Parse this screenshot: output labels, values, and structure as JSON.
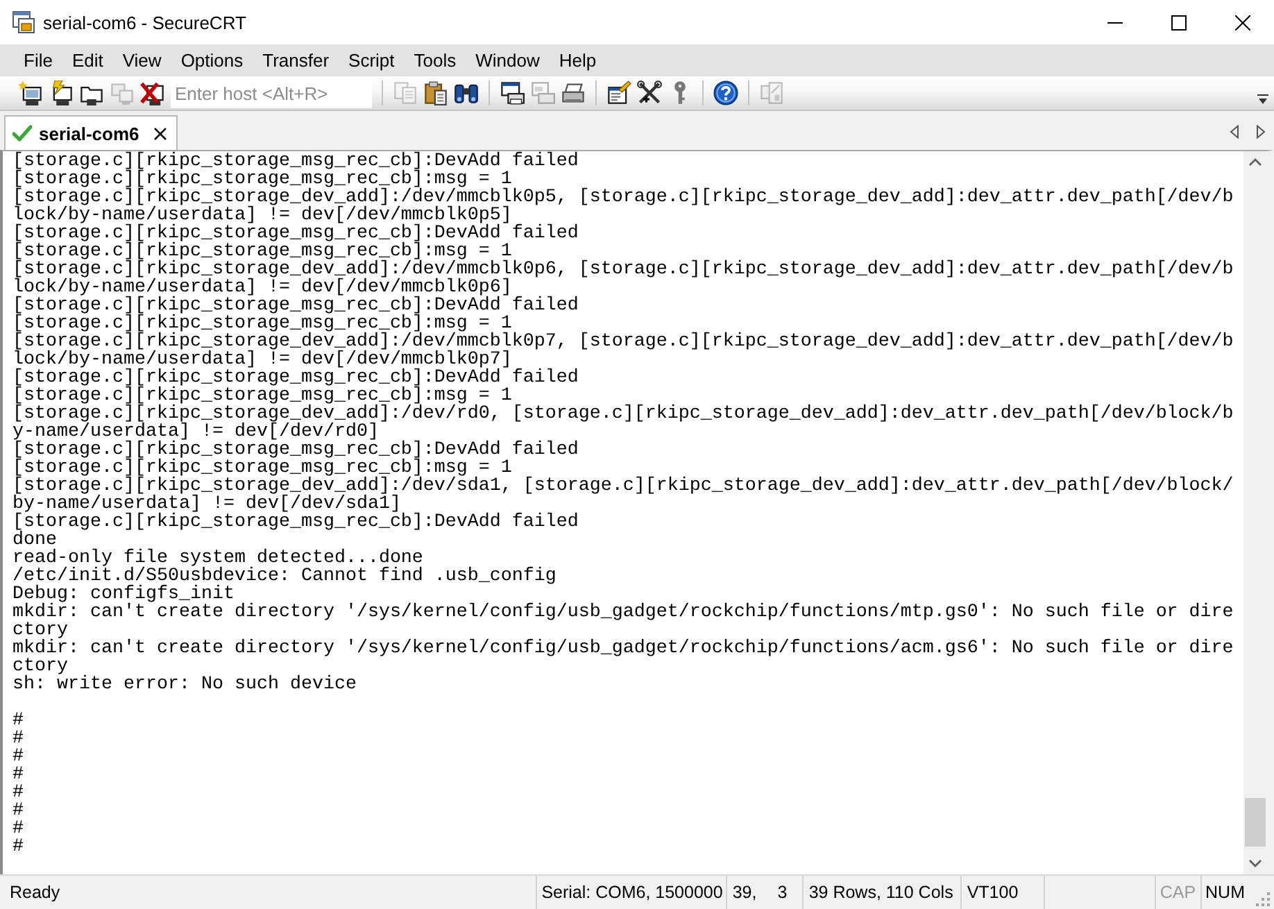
{
  "window": {
    "title": "serial-com6 - SecureCRT"
  },
  "menu": [
    {
      "label": "File"
    },
    {
      "label": "Edit"
    },
    {
      "label": "View"
    },
    {
      "label": "Options"
    },
    {
      "label": "Transfer"
    },
    {
      "label": "Script"
    },
    {
      "label": "Tools"
    },
    {
      "label": "Window"
    },
    {
      "label": "Help"
    }
  ],
  "toolbar": {
    "items": [
      {
        "kind": "connect",
        "disabled": false
      },
      {
        "kind": "quickconnect",
        "disabled": false
      },
      {
        "kind": "tabconnect",
        "disabled": false
      },
      {
        "kind": "reconnect",
        "disabled": true
      },
      {
        "kind": "disconnect",
        "disabled": false
      },
      {
        "kind": "host",
        "placeholder": "Enter host <Alt+R>"
      },
      {
        "kind": "separator"
      },
      {
        "kind": "copy",
        "disabled": true
      },
      {
        "kind": "paste",
        "disabled": false
      },
      {
        "kind": "find",
        "disabled": false
      },
      {
        "kind": "separator"
      },
      {
        "kind": "printscreen",
        "disabled": false
      },
      {
        "kind": "printselection",
        "disabled": true
      },
      {
        "kind": "print",
        "disabled": false
      },
      {
        "kind": "separator"
      },
      {
        "kind": "sessionoptions",
        "disabled": false
      },
      {
        "kind": "globaloptions",
        "disabled": false
      },
      {
        "kind": "keymap",
        "disabled": false
      },
      {
        "kind": "separator"
      },
      {
        "kind": "help",
        "disabled": false
      },
      {
        "kind": "separator"
      },
      {
        "kind": "tile",
        "disabled": true
      }
    ]
  },
  "tabs": [
    {
      "label": "serial-com6",
      "selected": true
    }
  ],
  "terminal": {
    "lines": [
      {
        "kind": "text",
        "text": "[storage.c][rkipc_storage_msg_rec_cb]:DevAdd failed"
      },
      {
        "kind": "text",
        "text": "[storage.c][rkipc_storage_msg_rec_cb]:msg = 1"
      },
      {
        "kind": "text",
        "text": "[storage.c][rkipc_storage_dev_add]:/dev/mmcblk0p5, [storage.c][rkipc_storage_dev_add]:dev_attr.dev_path[/dev/b"
      },
      {
        "kind": "text",
        "text": "lock/by-name/userdata] != dev[/dev/mmcblk0p5]"
      },
      {
        "kind": "text",
        "text": "[storage.c][rkipc_storage_msg_rec_cb]:DevAdd failed"
      },
      {
        "kind": "text",
        "text": "[storage.c][rkipc_storage_msg_rec_cb]:msg = 1"
      },
      {
        "kind": "text",
        "text": "[storage.c][rkipc_storage_dev_add]:/dev/mmcblk0p6, [storage.c][rkipc_storage_dev_add]:dev_attr.dev_path[/dev/b"
      },
      {
        "kind": "text",
        "text": "lock/by-name/userdata] != dev[/dev/mmcblk0p6]"
      },
      {
        "kind": "text",
        "text": "[storage.c][rkipc_storage_msg_rec_cb]:DevAdd failed"
      },
      {
        "kind": "text",
        "text": "[storage.c][rkipc_storage_msg_rec_cb]:msg = 1"
      },
      {
        "kind": "text",
        "text": "[storage.c][rkipc_storage_dev_add]:/dev/mmcblk0p7, [storage.c][rkipc_storage_dev_add]:dev_attr.dev_path[/dev/b"
      },
      {
        "kind": "text",
        "text": "lock/by-name/userdata] != dev[/dev/mmcblk0p7]"
      },
      {
        "kind": "text",
        "text": "[storage.c][rkipc_storage_msg_rec_cb]:DevAdd failed"
      },
      {
        "kind": "text",
        "text": "[storage.c][rkipc_storage_msg_rec_cb]:msg = 1"
      },
      {
        "kind": "text",
        "text": "[storage.c][rkipc_storage_dev_add]:/dev/rd0, [storage.c][rkipc_storage_dev_add]:dev_attr.dev_path[/dev/block/b"
      },
      {
        "kind": "text",
        "text": "y-name/userdata] != dev[/dev/rd0]"
      },
      {
        "kind": "text",
        "text": "[storage.c][rkipc_storage_msg_rec_cb]:DevAdd failed"
      },
      {
        "kind": "text",
        "text": "[storage.c][rkipc_storage_msg_rec_cb]:msg = 1"
      },
      {
        "kind": "text",
        "text": "[storage.c][rkipc_storage_dev_add]:/dev/sda1, [storage.c][rkipc_storage_dev_add]:dev_attr.dev_path[/dev/block/"
      },
      {
        "kind": "text",
        "text": "by-name/userdata] != dev[/dev/sda1]"
      },
      {
        "kind": "text",
        "text": "[storage.c][rkipc_storage_msg_rec_cb]:DevAdd failed"
      },
      {
        "kind": "text",
        "text": "done"
      },
      {
        "kind": "text",
        "text": "read-only file system detected...done"
      },
      {
        "kind": "text",
        "text": "/etc/init.d/S50usbdevice: Cannot find .usb_config"
      },
      {
        "kind": "text",
        "text": "Debug: configfs_init"
      },
      {
        "kind": "text",
        "text": "mkdir: can't create directory '/sys/kernel/config/usb_gadget/rockchip/functions/mtp.gs0': No such file or dire"
      },
      {
        "kind": "text",
        "text": "ctory"
      },
      {
        "kind": "text",
        "text": "mkdir: can't create directory '/sys/kernel/config/usb_gadget/rockchip/functions/acm.gs6': No such file or dire"
      },
      {
        "kind": "text",
        "text": "ctory"
      },
      {
        "kind": "text",
        "text": "sh: write error: No such device"
      },
      {
        "kind": "blank"
      },
      {
        "kind": "text",
        "text": "#"
      },
      {
        "kind": "text",
        "text": "#"
      },
      {
        "kind": "text",
        "text": "#"
      },
      {
        "kind": "text",
        "text": "#"
      },
      {
        "kind": "text",
        "text": "#"
      },
      {
        "kind": "text",
        "text": "#"
      },
      {
        "kind": "text",
        "text": "#"
      },
      {
        "kind": "text",
        "text": "#"
      }
    ]
  },
  "status_bar": {
    "message": "Ready",
    "connection": "Serial: COM6, 1500000",
    "cursor": {
      "row": "39,",
      "column": "3"
    },
    "size": "39 Rows, 110 Cols",
    "emulation": "VT100",
    "indicators": [
      {
        "label": "CAP",
        "on": false
      },
      {
        "label": "NUM",
        "on": true
      }
    ]
  }
}
